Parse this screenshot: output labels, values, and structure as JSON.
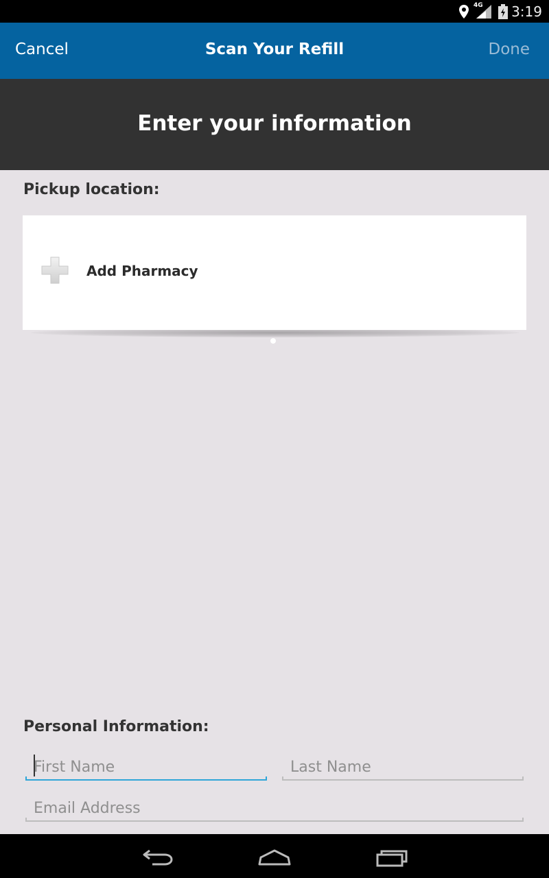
{
  "status_bar": {
    "time": "3:19",
    "network": "4G",
    "icons": [
      "location-icon",
      "signal-icon",
      "battery-icon"
    ]
  },
  "app_bar": {
    "cancel_label": "Cancel",
    "title": "Scan Your Refill",
    "done_label": "Done"
  },
  "header": {
    "heading": "Enter your information"
  },
  "pickup": {
    "label": "Pickup location:",
    "add_pharmacy_label": "Add Pharmacy"
  },
  "personal": {
    "label": "Personal Information:",
    "first_name_placeholder": "First Name",
    "last_name_placeholder": "Last Name",
    "email_placeholder": "Email Address",
    "first_name_value": "",
    "last_name_value": "",
    "email_value": ""
  },
  "nav_bar": {
    "buttons": [
      "back-icon",
      "home-icon",
      "recent-apps-icon"
    ]
  },
  "colors": {
    "app_bar": "#0563a0",
    "header": "#323232",
    "background": "#e6e2e6",
    "focus_underline": "#2fa6d8"
  }
}
